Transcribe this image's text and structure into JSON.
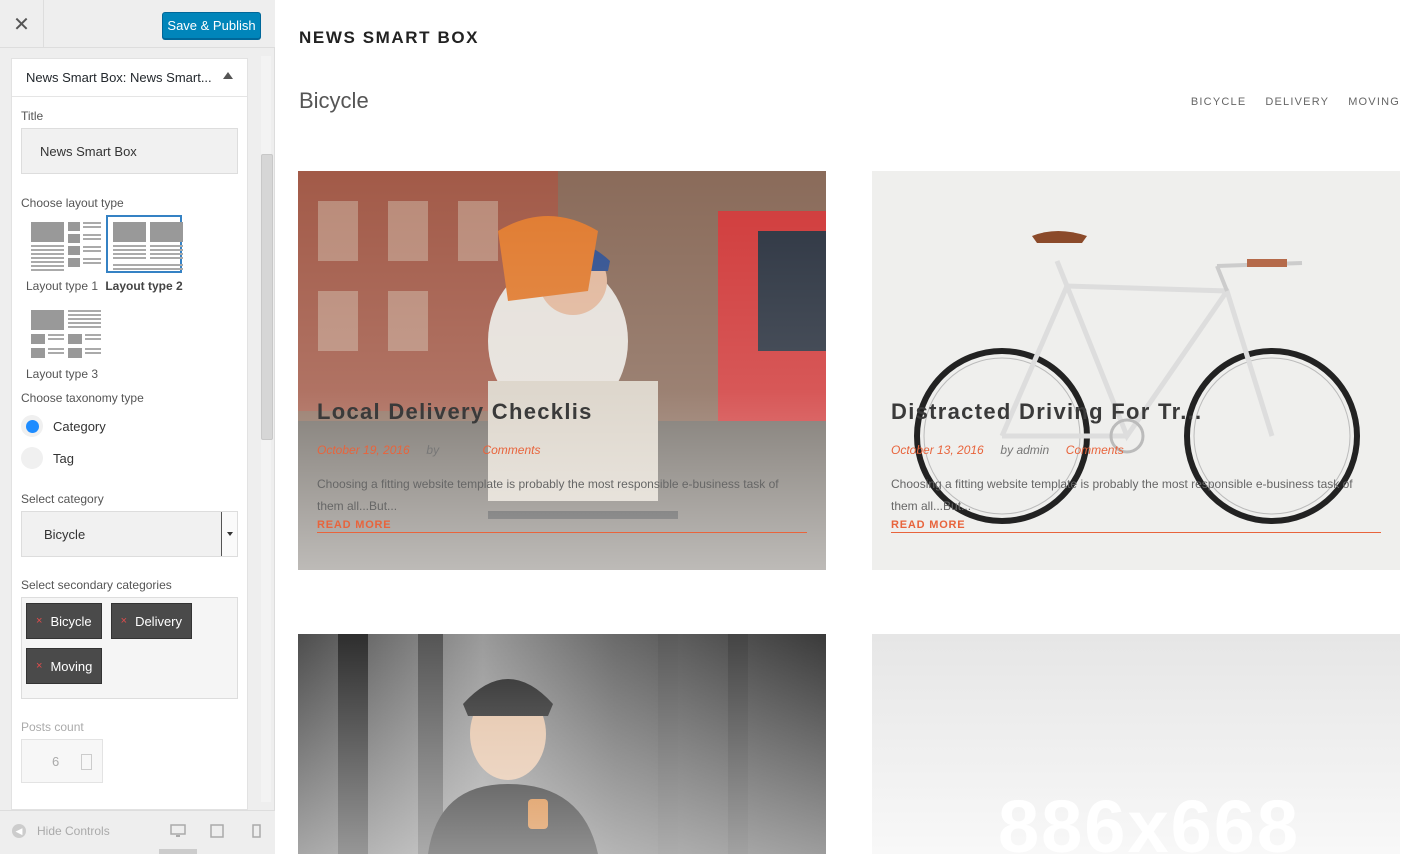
{
  "sidebar": {
    "close_glyph": "✕",
    "save_label": "Save & Publish",
    "widget_header": "News Smart Box: News Smart...",
    "title_label": "Title",
    "title_value": "News Smart Box",
    "layout_label": "Choose layout type",
    "layouts": [
      {
        "label": "Layout type 1",
        "selected": false
      },
      {
        "label": "Layout type 2",
        "selected": true
      },
      {
        "label": "Layout type 3",
        "selected": false
      }
    ],
    "taxonomy_label": "Choose taxonomy type",
    "taxonomy_options": [
      {
        "label": "Category",
        "checked": true
      },
      {
        "label": "Tag",
        "checked": false
      }
    ],
    "category_label": "Select category",
    "category_value": "Bicycle",
    "secondary_label": "Select secondary categories",
    "secondary_chips": [
      "Bicycle",
      "Delivery",
      "Moving"
    ],
    "chip_remove_glyph": "×",
    "posts_count_label": "Posts count",
    "posts_count_value": "6",
    "hide_controls_label": "Hide Controls",
    "device_icons": [
      "desktop-icon",
      "tablet-icon",
      "mobile-icon"
    ]
  },
  "preview": {
    "widget_title": "NEWS SMART BOX",
    "category_title": "Bicycle",
    "category_tabs": [
      "BICYCLE",
      "DELIVERY",
      "MOVING"
    ],
    "posts": [
      {
        "title": "Local Delivery Checklis",
        "date": "October 19, 2016",
        "by": "by",
        "author": "",
        "comments": "Comments",
        "excerpt": "Choosing a fitting website template is probably the most responsible e-business task of them all...But...",
        "read_more": "READ MORE",
        "image": "cyclist-courier"
      },
      {
        "title": "Distracted Driving For Tr...",
        "date": "October 13, 2016",
        "by": "by",
        "author": "admin",
        "comments": "Comments",
        "excerpt": "Choosing a fitting website template is probably the most responsible e-business task of them all...But...",
        "read_more": "READ MORE",
        "image": "white-bicycle"
      },
      {
        "image": "woman-cyclist-helmet"
      },
      {
        "image": "placeholder",
        "placeholder_text": "886x668"
      }
    ]
  },
  "colors": {
    "accent": "#0085ba",
    "link": "#e8643c",
    "selected_border": "#3582c4"
  }
}
